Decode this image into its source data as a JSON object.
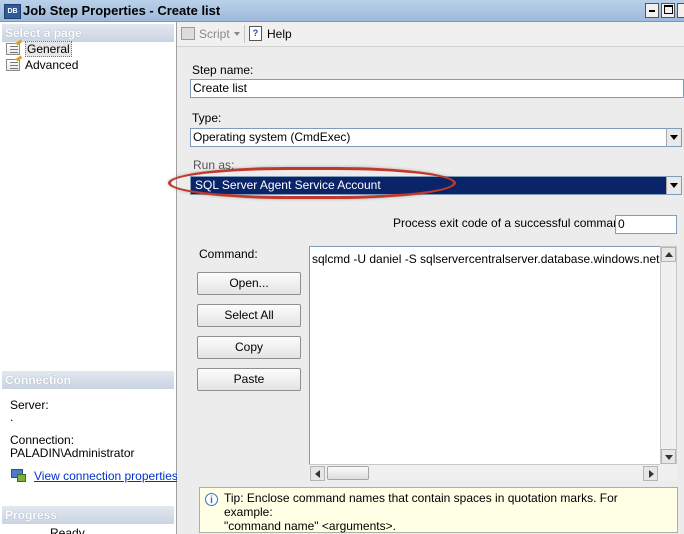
{
  "window": {
    "title": "Job Step Properties - Create list",
    "icon_text": "DB"
  },
  "left": {
    "select_page_header": "Select a page",
    "pages": [
      {
        "label": "General"
      },
      {
        "label": "Advanced"
      }
    ],
    "connection_header": "Connection",
    "server_label": "Server:",
    "server_value": ".",
    "connection_label": "Connection:",
    "connection_value": "PALADIN\\Administrator",
    "view_connection_link": "View connection properties",
    "progress_header": "Progress",
    "progress_item": "Ready"
  },
  "toolbar": {
    "script_label": "Script",
    "help_label": "Help"
  },
  "form": {
    "step_name_label": "Step name:",
    "step_name_value": "Create list",
    "type_label": "Type:",
    "type_value": "Operating system (CmdExec)",
    "run_as_label": "Run as:",
    "run_as_value": "SQL Server Agent Service Account",
    "exit_code_label": "Process exit code of a successful command:",
    "exit_code_value": "0",
    "command_label": "Command:",
    "command_value": "sqlcmd -U daniel -S sqlservercentralserver.database.windows.net -P \"Con",
    "buttons": {
      "open": "Open...",
      "select_all": "Select All",
      "copy": "Copy",
      "paste": "Paste"
    },
    "tip_line1": "Tip: Enclose command names that contain spaces in quotation marks. For example:",
    "tip_line2": "\"command name\" <arguments>."
  },
  "colors": {
    "selection_bg": "#0a246a",
    "highlight_ring": "#c0392b",
    "link": "#0033cc"
  }
}
